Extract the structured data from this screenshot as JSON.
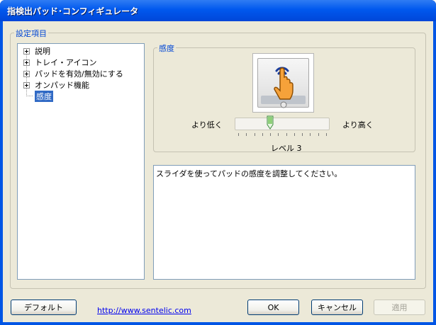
{
  "window": {
    "title": "指検出パッド･コンフィギュレータ"
  },
  "settings_group": {
    "label": "設定項目"
  },
  "tree": {
    "items": [
      {
        "label": "説明",
        "expandable": true
      },
      {
        "label": "トレイ・アイコン",
        "expandable": true
      },
      {
        "label": "パッドを有効/無効にする",
        "expandable": true
      },
      {
        "label": "オンパッド機能",
        "expandable": true
      },
      {
        "label": "感度",
        "expandable": false,
        "selected": true
      }
    ]
  },
  "sensitivity": {
    "group_label": "感度",
    "low_label": "より低く",
    "high_label": "より高く",
    "level_label": "レベル 3",
    "level": 3,
    "min_level": 1,
    "max_level": 12
  },
  "description": {
    "text": "スライダを使ってパッドの感度を調整してください。"
  },
  "buttons": {
    "default_label": "デフォルト",
    "ok_label": "OK",
    "cancel_label": "キャンセル",
    "apply_label": "適用"
  },
  "link": {
    "text": "http://www.sentelic.com"
  },
  "colors": {
    "title_bar": "#0058ee",
    "selection": "#316ac5",
    "accent_text": "#0046d5",
    "link": "#0000ee"
  }
}
